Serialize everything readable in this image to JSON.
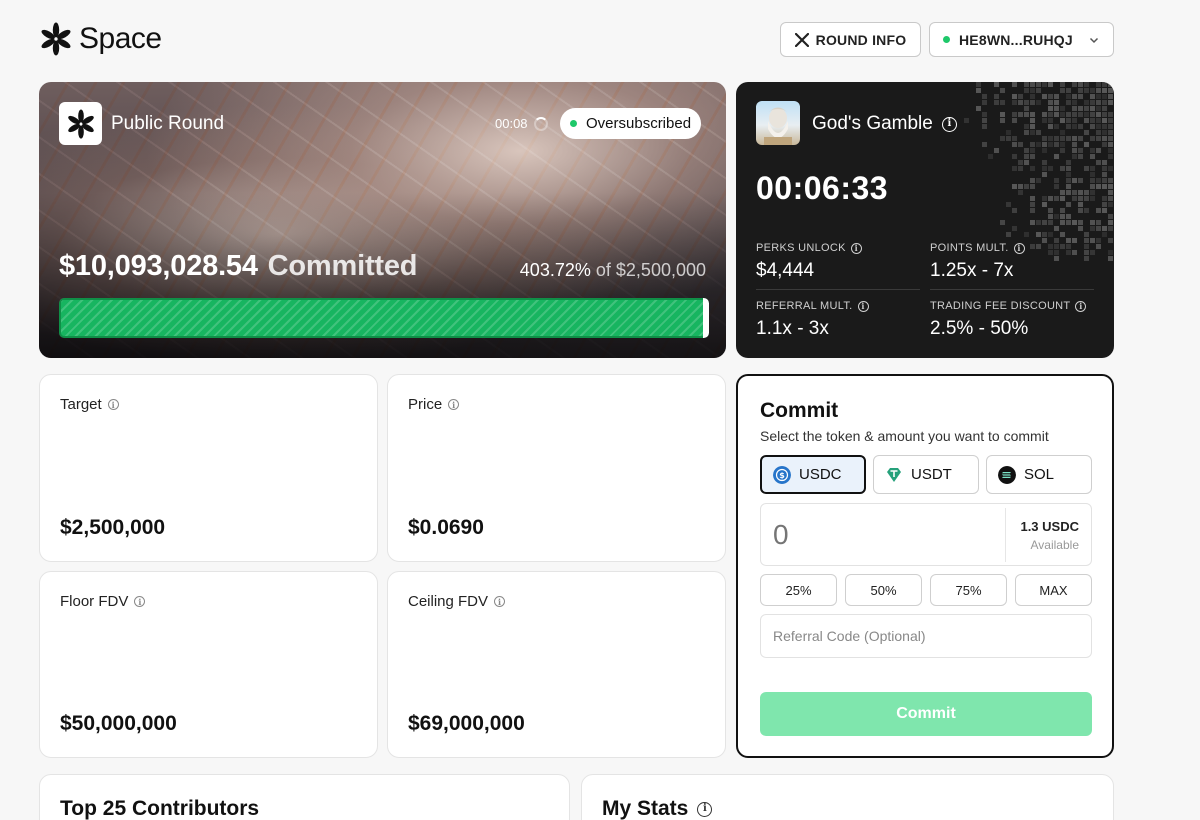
{
  "brand": {
    "name": "Space"
  },
  "header": {
    "round_info_label": "ROUND INFO",
    "wallet_label": "HE8WN...RUHQJ",
    "wallet_status_color": "#1ec86a"
  },
  "hero": {
    "title": "Public Round",
    "timer": "00:08",
    "badge": "Oversubscribed",
    "committed_amount": "$10,093,028.54",
    "committed_label": "Committed",
    "percent": "403.72%",
    "of_label": "of",
    "target": "$2,500,000",
    "progress_fraction": 1.0,
    "progress_color": "#17b560"
  },
  "gamble": {
    "title": "God's Gamble",
    "countdown": "00:06:33",
    "stats": [
      {
        "label": "PERKS UNLOCK",
        "value": "$4,444"
      },
      {
        "label": "POINTS MULT.",
        "value": "1.25x - 7x"
      },
      {
        "label": "REFERRAL MULT.",
        "value": "1.1x - 3x"
      },
      {
        "label": "TRADING FEE DISCOUNT",
        "value": "2.5% - 50%"
      }
    ]
  },
  "info_cards": [
    {
      "label": "Target",
      "value": "$2,500,000"
    },
    {
      "label": "Price",
      "value": "$0.0690"
    },
    {
      "label": "Floor FDV",
      "value": "$50,000,000"
    },
    {
      "label": "Ceiling FDV",
      "value": "$69,000,000"
    }
  ],
  "commit": {
    "title": "Commit",
    "subtitle": "Select the token & amount you want to commit",
    "tokens": [
      {
        "label": "USDC",
        "selected": true,
        "color": "#2775ca"
      },
      {
        "label": "USDT",
        "selected": false,
        "color": "#26a17b"
      },
      {
        "label": "SOL",
        "selected": false,
        "color": "#111111"
      }
    ],
    "amount_placeholder": "0",
    "available_value": "1.3 USDC",
    "available_label": "Available",
    "percent_buttons": [
      "25%",
      "50%",
      "75%",
      "MAX"
    ],
    "referral_placeholder": "Referral Code (Optional)",
    "submit_label": "Commit",
    "submit_color": "#7fe6ad"
  },
  "bottom": {
    "contributors_title": "Top 25 Contributors",
    "stats_title": "My Stats"
  }
}
